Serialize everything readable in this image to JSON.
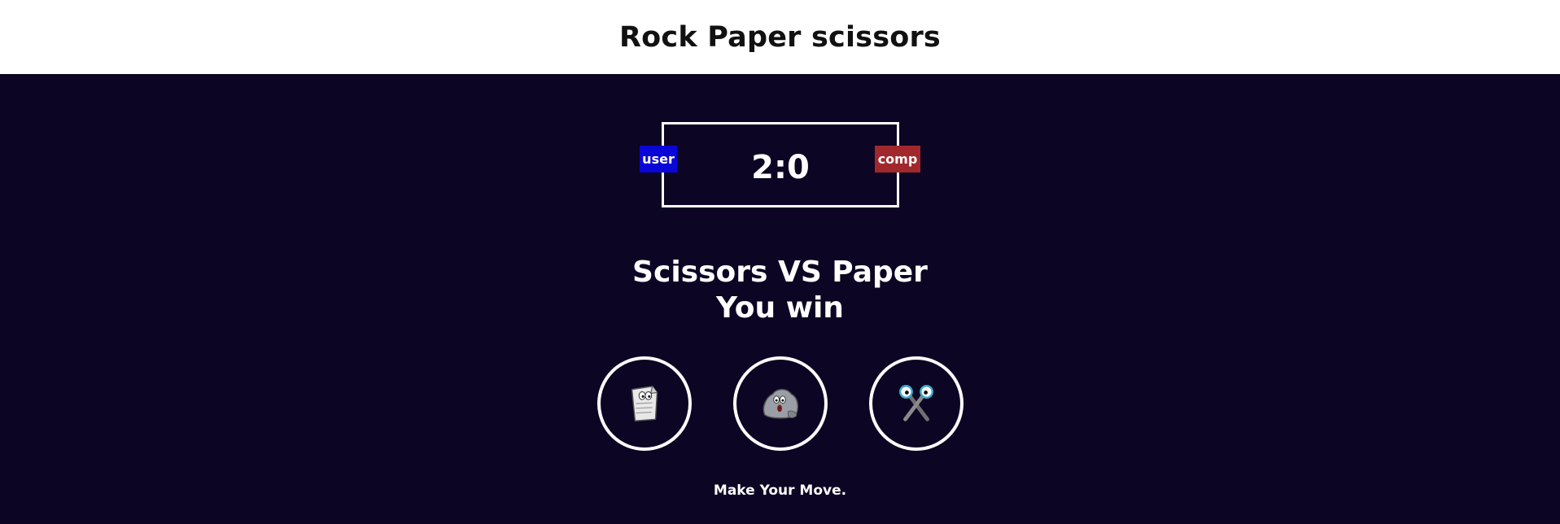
{
  "header": {
    "title": "Rock Paper scissors"
  },
  "scoreboard": {
    "score": "2:0",
    "user_label": "user",
    "comp_label": "comp"
  },
  "result": {
    "matchup": "Scissors VS Paper",
    "outcome": "You win"
  },
  "choices": [
    {
      "id": "paper",
      "icon": "paper-icon"
    },
    {
      "id": "rock",
      "icon": "rock-icon"
    },
    {
      "id": "scissors",
      "icon": "scissors-icon"
    }
  ],
  "message": "Make Your Move.",
  "colors": {
    "background": "#0c0524",
    "header_bg": "#ffffff",
    "user_badge": "#0a06d8",
    "comp_badge": "#a0282c",
    "outline": "#ffffff"
  }
}
